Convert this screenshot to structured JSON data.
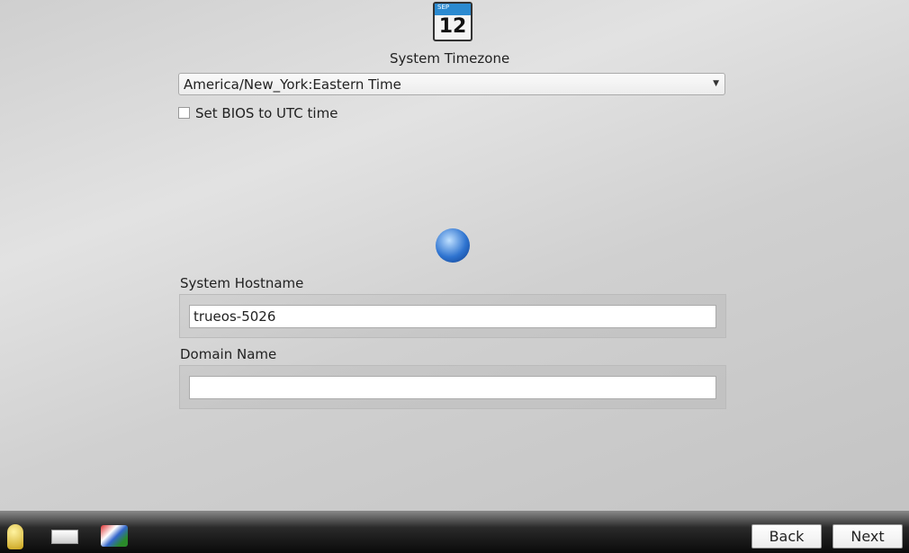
{
  "timezone": {
    "title": "System Timezone",
    "calendar_month": "SEP",
    "calendar_day": "12",
    "selected": "America/New_York:Eastern Time",
    "bios_utc_label": "Set BIOS to UTC time",
    "bios_utc_checked": false
  },
  "network": {
    "hostname_label": "System Hostname",
    "hostname_value": "trueos-5026",
    "domain_label": "Domain Name",
    "domain_value": ""
  },
  "bottom": {
    "back_label": "Back",
    "next_label": "Next",
    "icons": [
      "lightbulb-icon",
      "keyboard-icon",
      "language-flag-icon"
    ]
  }
}
